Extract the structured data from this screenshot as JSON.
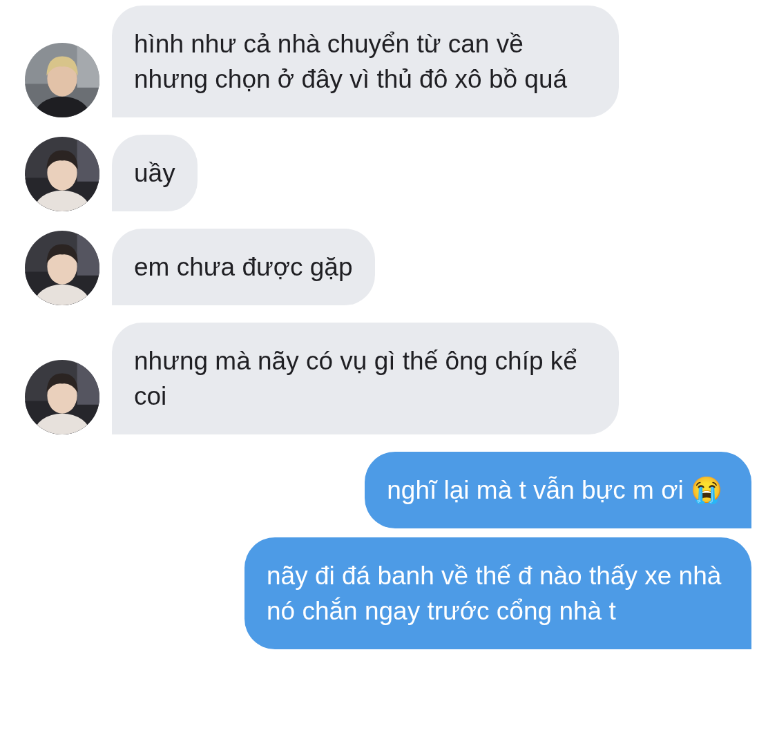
{
  "messages": [
    {
      "kind": "received",
      "text": "hình như cả nhà chuyển từ can về nhưng chọn ở đây vì thủ đô xô bồ quá"
    },
    {
      "kind": "received",
      "text": "uầy"
    },
    {
      "kind": "received",
      "text": "em chưa được gặp"
    },
    {
      "kind": "received",
      "text": "nhưng mà nãy có vụ gì thế ông chíp kể coi"
    },
    {
      "kind": "sent",
      "text": "nghĩ lại mà t vẫn bực m ơi 😭"
    },
    {
      "kind": "sent",
      "text": "nãy đi đá banh về thế đ nào thấy xe nhà nó chắn ngay trước cổng nhà t"
    }
  ]
}
